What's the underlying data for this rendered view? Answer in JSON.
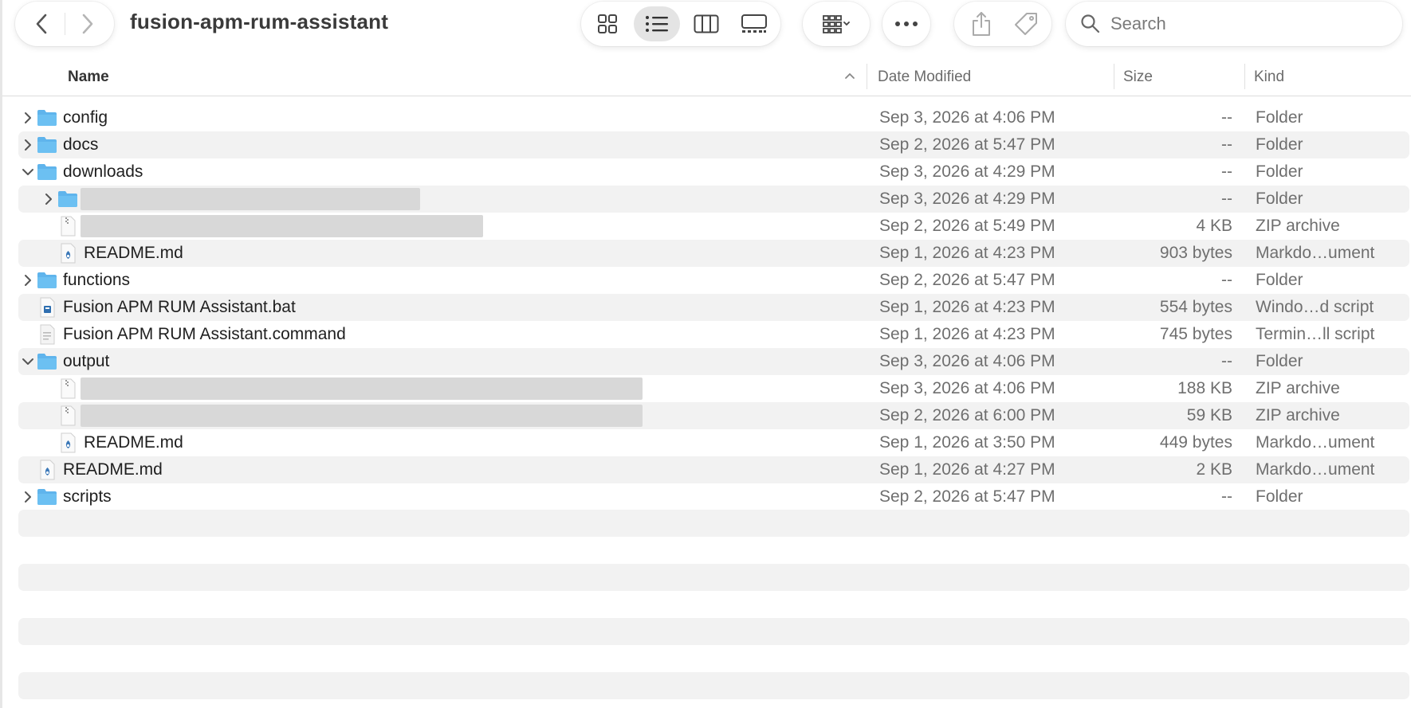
{
  "window": {
    "title": "fusion-apm-rum-assistant"
  },
  "toolbar": {
    "back_icon": "chevron-left-icon",
    "forward_icon": "chevron-right-icon",
    "views": [
      "icon-view",
      "list-view",
      "column-view",
      "gallery-view"
    ],
    "active_view": "list-view",
    "search_placeholder": "Search"
  },
  "columns": {
    "name": "Name",
    "date": "Date Modified",
    "size": "Size",
    "kind": "Kind"
  },
  "rows": [
    {
      "name": "config",
      "date": "Sep 3, 2026 at 4:06 PM",
      "size": "--",
      "kind": "Folder"
    },
    {
      "name": "docs",
      "date": "Sep 2, 2026 at 5:47 PM",
      "size": "--",
      "kind": "Folder"
    },
    {
      "name": "downloads",
      "date": "Sep 3, 2026 at 4:29 PM",
      "size": "--",
      "kind": "Folder"
    },
    {
      "name": "",
      "date": "Sep 3, 2026 at 4:29 PM",
      "size": "--",
      "kind": "Folder"
    },
    {
      "name": "",
      "date": "Sep 2, 2026 at 5:49 PM",
      "size": "4 KB",
      "kind": "ZIP archive"
    },
    {
      "name": "README.md",
      "date": "Sep 1, 2026 at 4:23 PM",
      "size": "903 bytes",
      "kind": "Markdo…ument"
    },
    {
      "name": "functions",
      "date": "Sep 2, 2026 at 5:47 PM",
      "size": "--",
      "kind": "Folder"
    },
    {
      "name": "Fusion APM RUM Assistant.bat",
      "date": "Sep 1, 2026 at 4:23 PM",
      "size": "554 bytes",
      "kind": "Windo…d script"
    },
    {
      "name": "Fusion APM RUM Assistant.command",
      "date": "Sep 1, 2026 at 4:23 PM",
      "size": "745 bytes",
      "kind": "Termin…ll script"
    },
    {
      "name": "output",
      "date": "Sep 3, 2026 at 4:06 PM",
      "size": "--",
      "kind": "Folder"
    },
    {
      "name": "",
      "date": "Sep 3, 2026 at 4:06 PM",
      "size": "188 KB",
      "kind": "ZIP archive"
    },
    {
      "name": "",
      "date": "Sep 2, 2026 at 6:00 PM",
      "size": "59 KB",
      "kind": "ZIP archive"
    },
    {
      "name": "README.md",
      "date": "Sep 1, 2026 at 3:50 PM",
      "size": "449 bytes",
      "kind": "Markdo…ument"
    },
    {
      "name": "README.md",
      "date": "Sep 1, 2026 at 4:27 PM",
      "size": "2 KB",
      "kind": "Markdo…ument"
    },
    {
      "name": "scripts",
      "date": "Sep 2, 2026 at 5:47 PM",
      "size": "--",
      "kind": "Folder"
    }
  ],
  "colors": {
    "folder": "#5fb4ec",
    "stripe": "#f2f2f2",
    "active_view_bg": "#e4e4e4"
  }
}
